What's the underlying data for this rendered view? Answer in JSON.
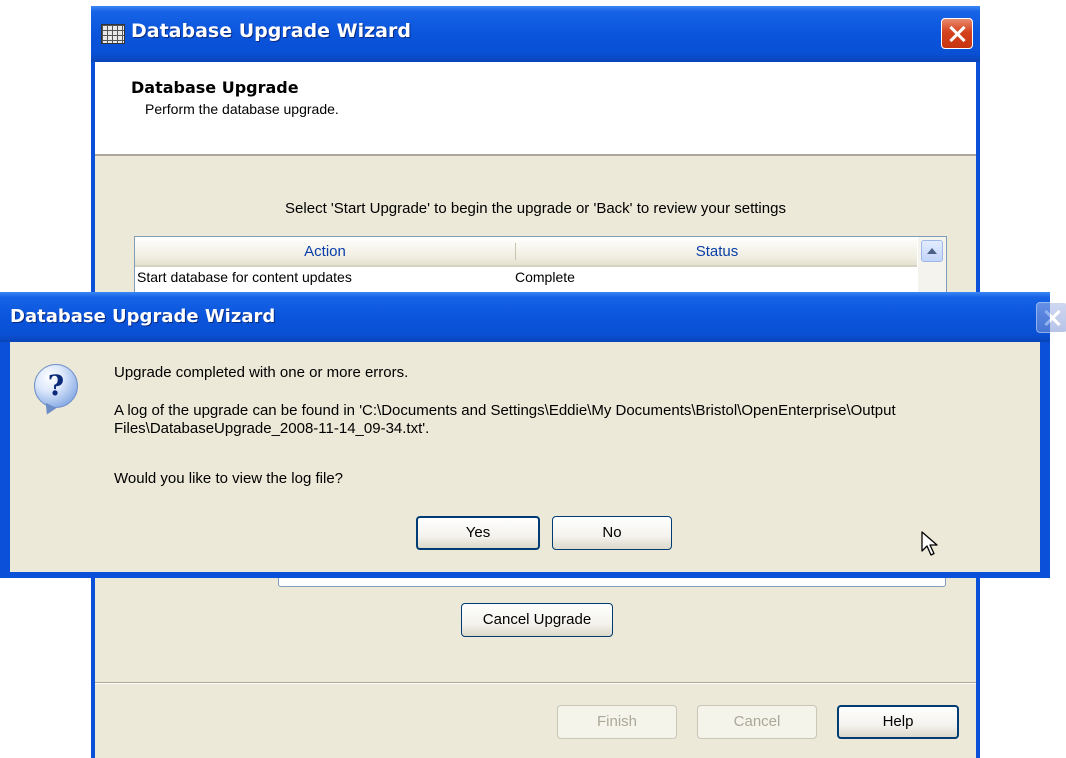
{
  "wizard": {
    "title": "Database Upgrade Wizard",
    "header_title": "Database Upgrade",
    "header_subtitle": "Perform the database upgrade.",
    "instruction": "Select 'Start Upgrade' to begin the upgrade or 'Back' to review your settings",
    "columns": [
      "Action",
      "Status"
    ],
    "rows": [
      {
        "action": "Start database for content updates",
        "status": "Complete"
      }
    ],
    "cancel_upgrade_label": "Cancel Upgrade",
    "finish_label": "Finish",
    "cancel_label": "Cancel",
    "help_label": "Help"
  },
  "dialog": {
    "title": "Database Upgrade Wizard",
    "icon": "question-icon",
    "message_line1": "Upgrade completed with one or more errors.",
    "message_line2": "A log of the upgrade can be found in 'C:\\Documents and Settings\\Eddie\\My Documents\\Bristol\\OpenEnterprise\\Output Files\\DatabaseUpgrade_2008-11-14_09-34.txt'.",
    "message_line3": "Would you like to view the log file?",
    "yes_label": "Yes",
    "no_label": "No"
  },
  "colors": {
    "titlebar_blue": "#0a55dc",
    "dialog_face": "#ece9d8",
    "close_red": "#d4421d",
    "column_header_text": "#0a3ea8"
  }
}
